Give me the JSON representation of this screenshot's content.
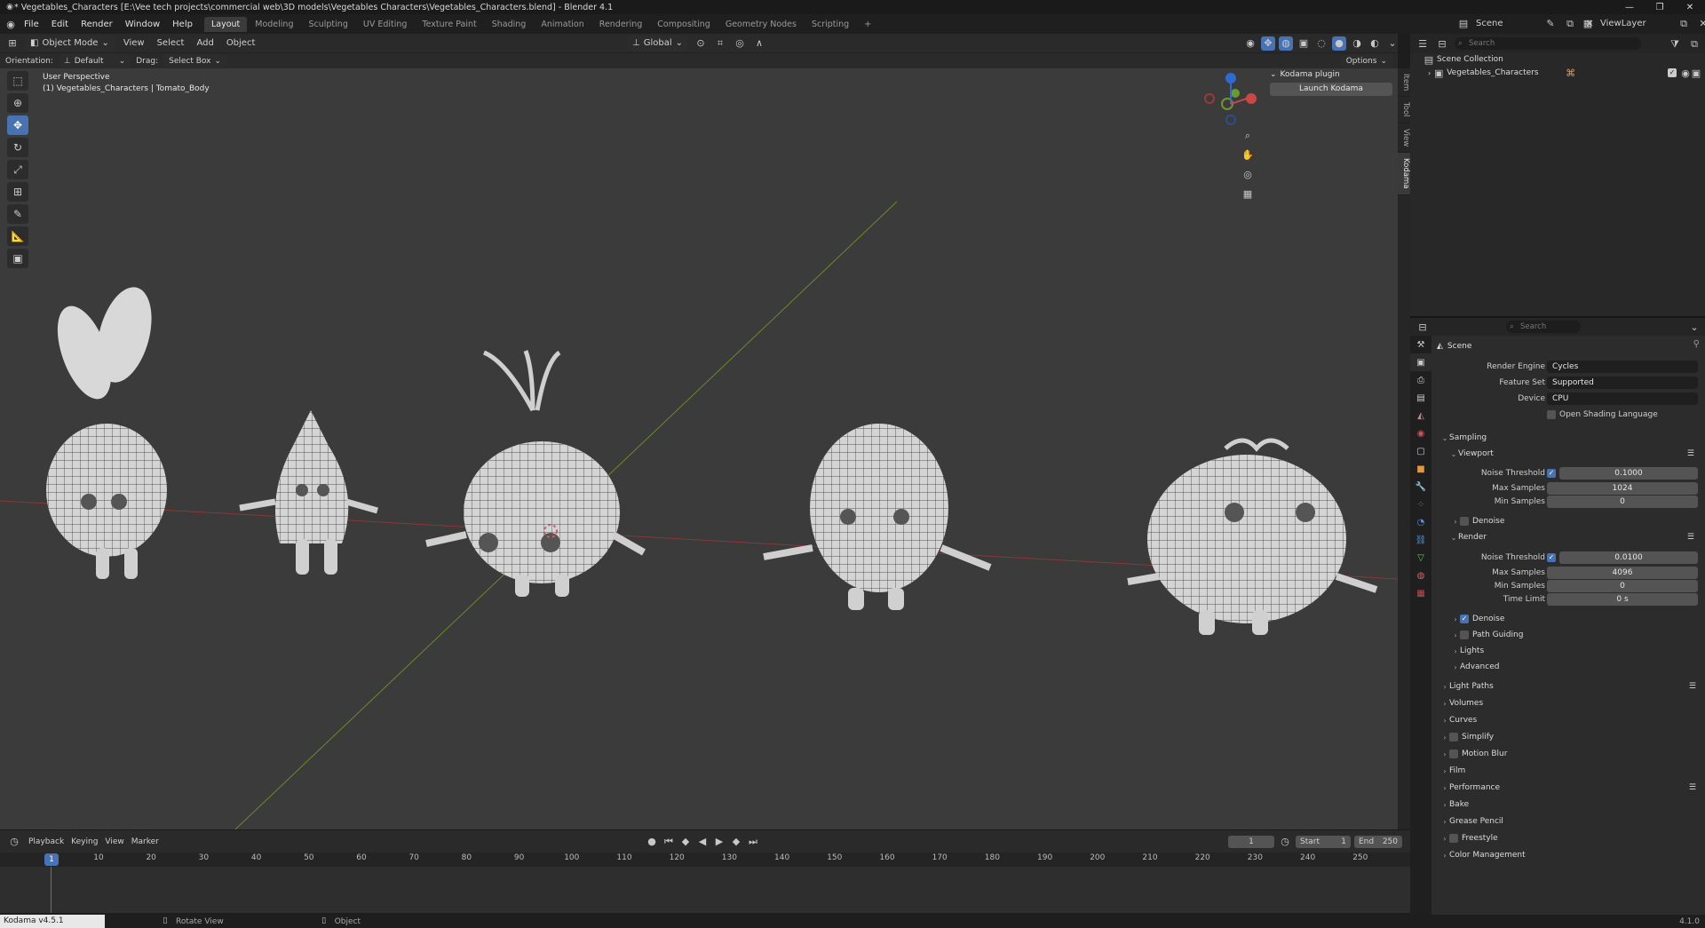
{
  "titlebar": {
    "title": "* Vegetables_Characters [E:\\Vee tech projects\\commercial web\\3D models\\Vegetables Characters\\Vegetables_Characters.blend] - Blender 4.1"
  },
  "menu": [
    "File",
    "Edit",
    "Render",
    "Window",
    "Help"
  ],
  "workspaces": [
    "Layout",
    "Modeling",
    "Sculpting",
    "UV Editing",
    "Texture Paint",
    "Shading",
    "Animation",
    "Rendering",
    "Compositing",
    "Geometry Nodes",
    "Scripting"
  ],
  "topright": {
    "scene": "Scene",
    "view_layer": "ViewLayer"
  },
  "viewport": {
    "mode": "Object Mode",
    "menus": [
      "View",
      "Select",
      "Add",
      "Object"
    ],
    "orientation_label": "Orientation:",
    "orientation": "Default",
    "drag_label": "Drag:",
    "drag": "Select Box",
    "transform": "Global",
    "options": "Options",
    "overlay_title": "User Perspective",
    "overlay_object": "(1) Vegetables_Characters | Tomato_Body",
    "search_placeholder": "Search",
    "npanel_title": "Kodama plugin",
    "npanel_button": "Launch Kodama",
    "npanel_tabs": [
      "Item",
      "Tool",
      "View",
      "Kodama"
    ]
  },
  "outliner": {
    "root": "Scene Collection",
    "collection": "Vegetables_Characters",
    "search_placeholder": "Search"
  },
  "properties": {
    "search_placeholder": "Search",
    "context": "Scene",
    "render_engine_label": "Render Engine",
    "render_engine": "Cycles",
    "feature_set_label": "Feature Set",
    "feature_set": "Supported",
    "device_label": "Device",
    "device": "CPU",
    "osl": "Open Shading Language",
    "sampling": "Sampling",
    "viewport": "Viewport",
    "noise_threshold": "Noise Threshold",
    "vp_noise": "0.1000",
    "max_samples": "Max Samples",
    "vp_max": "1024",
    "min_samples": "Min Samples",
    "vp_min": "0",
    "denoise": "Denoise",
    "render": "Render",
    "r_noise": "0.0100",
    "r_max": "4096",
    "r_min": "0",
    "time_limit": "Time Limit",
    "r_time": "0 s",
    "path_guiding": "Path Guiding",
    "lights": "Lights",
    "advanced": "Advanced",
    "sections": [
      "Light Paths",
      "Volumes",
      "Curves",
      "Simplify",
      "Motion Blur",
      "Film",
      "Performance",
      "Bake",
      "Grease Pencil",
      "Freestyle",
      "Color Management"
    ]
  },
  "timeline": {
    "menus": [
      "Playback",
      "Keying",
      "View",
      "Marker"
    ],
    "current_frame": "1",
    "start_label": "Start",
    "start": "1",
    "end_label": "End",
    "end": "250",
    "ticks": [
      "1",
      "10",
      "20",
      "30",
      "40",
      "50",
      "60",
      "70",
      "80",
      "90",
      "100",
      "110",
      "120",
      "130",
      "140",
      "150",
      "160",
      "170",
      "180",
      "190",
      "200",
      "210",
      "220",
      "230",
      "240",
      "250"
    ]
  },
  "status": {
    "left": "Kodama v4.5.1",
    "hint1": "Rotate View",
    "hint2": "Object",
    "version": "4.1.0"
  },
  "colors": {
    "accent": "#4772b3",
    "x_axis": "#8a3838",
    "y_axis": "#6a8a2a"
  }
}
